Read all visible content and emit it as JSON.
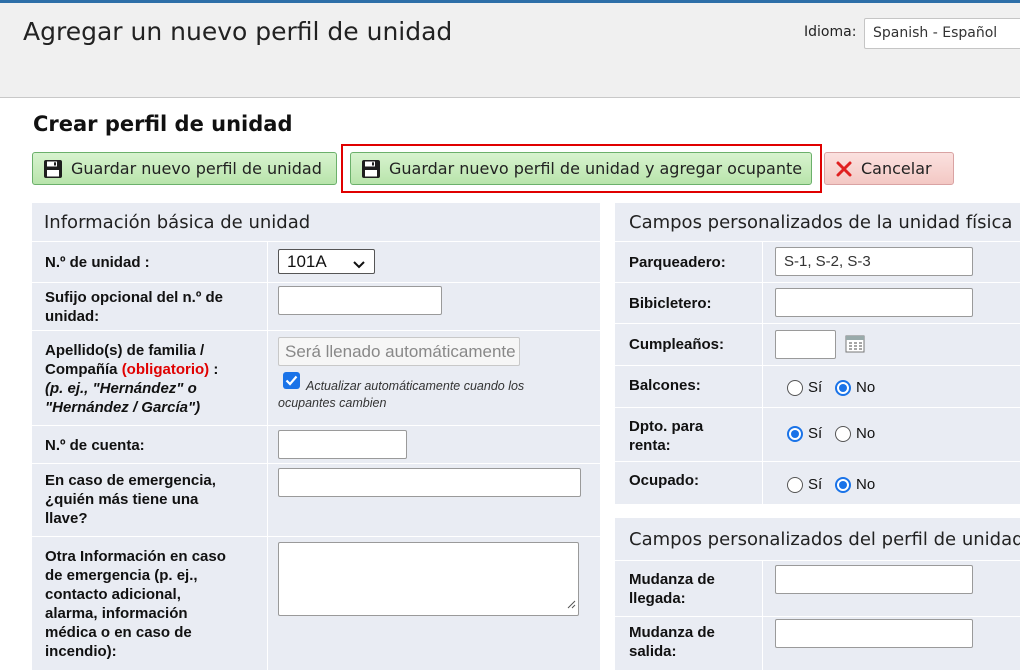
{
  "header": {
    "title": "Agregar un nuevo perfil de unidad",
    "language_label": "Idioma:",
    "language_value": "Spanish - Español"
  },
  "page": {
    "section_title": "Crear perfil de unidad"
  },
  "toolbar": {
    "save_label": "Guardar nuevo perfil de unidad",
    "save_add_label": "Guardar nuevo perfil de unidad y agregar ocupante",
    "cancel_label": "Cancelar"
  },
  "basic": {
    "heading": "Información básica de unidad",
    "unit_no_label": "N.º de unidad :",
    "unit_no_value": "101A",
    "suffix_label_1": "Sufijo opcional del n.º de",
    "suffix_label_2": "unidad:",
    "family_label_1": "Apellido(s) de familia /",
    "family_label_2a": "Compañía",
    "family_required": "(obligatorio)",
    "family_label_2b": ":",
    "family_example_1": "(p. ej., \"Hernández\" o",
    "family_example_2": "\"Hernández / García\")",
    "family_placeholder": "Será llenado automáticamente",
    "auto_update_label_1": "Actualizar automáticamente cuando los",
    "auto_update_label_2": "ocupantes cambien",
    "account_label": "N.º de cuenta:",
    "emergency_key_label_1": "En caso de emergencia,",
    "emergency_key_label_2": "¿quién más tiene una",
    "emergency_key_label_3": "llave?",
    "other_info_label_1": "Otra Información en caso",
    "other_info_label_2": "de emergencia (p. ej.,",
    "other_info_label_3": "contacto adicional,",
    "other_info_label_4": "alarma, información",
    "other_info_label_5": "médica o en caso de",
    "other_info_label_6": "incendio):"
  },
  "physical": {
    "heading": "Campos personalizados de la unidad física",
    "parking_label": "Parqueadero:",
    "parking_value": "S-1, S-2, S-3",
    "bike_label": "Bibicletero:",
    "birthday_label": "Cumpleaños:",
    "balcony_label": "Balcones:",
    "rental_label_1": "Dpto. para",
    "rental_label_2": "renta:",
    "occupied_label": "Ocupado:",
    "yes": "Sí",
    "no": "No",
    "balcony_selected": "No",
    "rental_selected": "Sí",
    "occupied_selected": "No"
  },
  "profile": {
    "heading": "Campos personalizados del perfil de unidad",
    "move_in_label_1": "Mudanza de",
    "move_in_label_2": "llegada:",
    "move_out_label_1": "Mudanza de",
    "move_out_label_2": "salida:"
  },
  "icons": {
    "save": "floppy-disk-icon",
    "cancel": "x-icon",
    "calendar": "calendar-icon",
    "dropdown": "chevron-down-icon"
  }
}
